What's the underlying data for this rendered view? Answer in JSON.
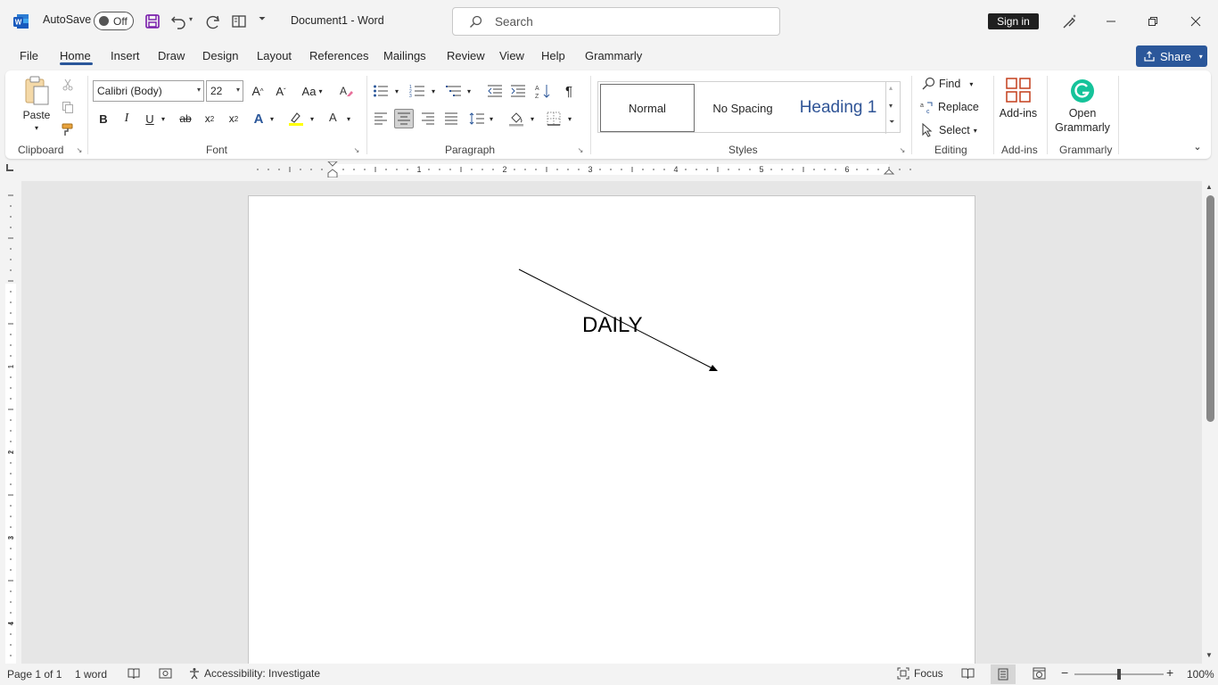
{
  "titlebar": {
    "autosave_label": "AutoSave",
    "autosave_state": "Off",
    "document_title": "Document1  -  Word",
    "search_placeholder": "Search",
    "sign_in": "Sign in"
  },
  "tabs": [
    "File",
    "Home",
    "Insert",
    "Draw",
    "Design",
    "Layout",
    "References",
    "Mailings",
    "Review",
    "View",
    "Help",
    "Grammarly"
  ],
  "active_tab": "Home",
  "share_label": "Share",
  "ribbon": {
    "clipboard": {
      "paste": "Paste",
      "group": "Clipboard"
    },
    "font": {
      "font_name": "Calibri (Body)",
      "font_size": "22",
      "change_case": "Aa",
      "group": "Font"
    },
    "paragraph": {
      "group": "Paragraph"
    },
    "styles": {
      "normal": "Normal",
      "no_spacing": "No Spacing",
      "heading1": "Heading 1",
      "group": "Styles"
    },
    "editing": {
      "find": "Find",
      "replace": "Replace",
      "select": "Select",
      "group": "Editing"
    },
    "addins": {
      "label": "Add-ins",
      "group": "Add-ins"
    },
    "grammarly": {
      "label_line1": "Open",
      "label_line2": "Grammarly",
      "group": "Grammarly"
    }
  },
  "ruler_numbers": [
    "1",
    "2",
    "3",
    "4",
    "5",
    "6"
  ],
  "vruler_numbers": [
    "1",
    "2",
    "3",
    "4"
  ],
  "document": {
    "text": "DAILY"
  },
  "status": {
    "page": "Page 1 of 1",
    "words": "1 word",
    "accessibility": "Accessibility: Investigate",
    "focus": "Focus",
    "zoom": "100%"
  },
  "colors": {
    "accent": "#2b579a",
    "heading": "#2f5496",
    "grammarly": "#15c39a",
    "addins": "#c43e1c",
    "save": "#7719aa"
  }
}
